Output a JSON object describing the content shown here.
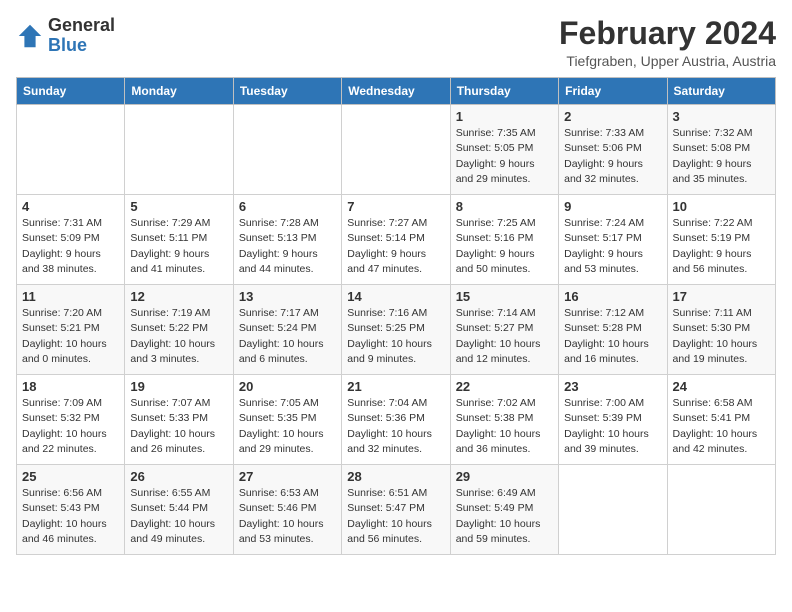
{
  "logo": {
    "line1": "General",
    "line2": "Blue"
  },
  "title": "February 2024",
  "subtitle": "Tiefgraben, Upper Austria, Austria",
  "headers": [
    "Sunday",
    "Monday",
    "Tuesday",
    "Wednesday",
    "Thursday",
    "Friday",
    "Saturday"
  ],
  "weeks": [
    [
      {
        "day": "",
        "info": ""
      },
      {
        "day": "",
        "info": ""
      },
      {
        "day": "",
        "info": ""
      },
      {
        "day": "",
        "info": ""
      },
      {
        "day": "1",
        "info": "Sunrise: 7:35 AM\nSunset: 5:05 PM\nDaylight: 9 hours\nand 29 minutes."
      },
      {
        "day": "2",
        "info": "Sunrise: 7:33 AM\nSunset: 5:06 PM\nDaylight: 9 hours\nand 32 minutes."
      },
      {
        "day": "3",
        "info": "Sunrise: 7:32 AM\nSunset: 5:08 PM\nDaylight: 9 hours\nand 35 minutes."
      }
    ],
    [
      {
        "day": "4",
        "info": "Sunrise: 7:31 AM\nSunset: 5:09 PM\nDaylight: 9 hours\nand 38 minutes."
      },
      {
        "day": "5",
        "info": "Sunrise: 7:29 AM\nSunset: 5:11 PM\nDaylight: 9 hours\nand 41 minutes."
      },
      {
        "day": "6",
        "info": "Sunrise: 7:28 AM\nSunset: 5:13 PM\nDaylight: 9 hours\nand 44 minutes."
      },
      {
        "day": "7",
        "info": "Sunrise: 7:27 AM\nSunset: 5:14 PM\nDaylight: 9 hours\nand 47 minutes."
      },
      {
        "day": "8",
        "info": "Sunrise: 7:25 AM\nSunset: 5:16 PM\nDaylight: 9 hours\nand 50 minutes."
      },
      {
        "day": "9",
        "info": "Sunrise: 7:24 AM\nSunset: 5:17 PM\nDaylight: 9 hours\nand 53 minutes."
      },
      {
        "day": "10",
        "info": "Sunrise: 7:22 AM\nSunset: 5:19 PM\nDaylight: 9 hours\nand 56 minutes."
      }
    ],
    [
      {
        "day": "11",
        "info": "Sunrise: 7:20 AM\nSunset: 5:21 PM\nDaylight: 10 hours\nand 0 minutes."
      },
      {
        "day": "12",
        "info": "Sunrise: 7:19 AM\nSunset: 5:22 PM\nDaylight: 10 hours\nand 3 minutes."
      },
      {
        "day": "13",
        "info": "Sunrise: 7:17 AM\nSunset: 5:24 PM\nDaylight: 10 hours\nand 6 minutes."
      },
      {
        "day": "14",
        "info": "Sunrise: 7:16 AM\nSunset: 5:25 PM\nDaylight: 10 hours\nand 9 minutes."
      },
      {
        "day": "15",
        "info": "Sunrise: 7:14 AM\nSunset: 5:27 PM\nDaylight: 10 hours\nand 12 minutes."
      },
      {
        "day": "16",
        "info": "Sunrise: 7:12 AM\nSunset: 5:28 PM\nDaylight: 10 hours\nand 16 minutes."
      },
      {
        "day": "17",
        "info": "Sunrise: 7:11 AM\nSunset: 5:30 PM\nDaylight: 10 hours\nand 19 minutes."
      }
    ],
    [
      {
        "day": "18",
        "info": "Sunrise: 7:09 AM\nSunset: 5:32 PM\nDaylight: 10 hours\nand 22 minutes."
      },
      {
        "day": "19",
        "info": "Sunrise: 7:07 AM\nSunset: 5:33 PM\nDaylight: 10 hours\nand 26 minutes."
      },
      {
        "day": "20",
        "info": "Sunrise: 7:05 AM\nSunset: 5:35 PM\nDaylight: 10 hours\nand 29 minutes."
      },
      {
        "day": "21",
        "info": "Sunrise: 7:04 AM\nSunset: 5:36 PM\nDaylight: 10 hours\nand 32 minutes."
      },
      {
        "day": "22",
        "info": "Sunrise: 7:02 AM\nSunset: 5:38 PM\nDaylight: 10 hours\nand 36 minutes."
      },
      {
        "day": "23",
        "info": "Sunrise: 7:00 AM\nSunset: 5:39 PM\nDaylight: 10 hours\nand 39 minutes."
      },
      {
        "day": "24",
        "info": "Sunrise: 6:58 AM\nSunset: 5:41 PM\nDaylight: 10 hours\nand 42 minutes."
      }
    ],
    [
      {
        "day": "25",
        "info": "Sunrise: 6:56 AM\nSunset: 5:43 PM\nDaylight: 10 hours\nand 46 minutes."
      },
      {
        "day": "26",
        "info": "Sunrise: 6:55 AM\nSunset: 5:44 PM\nDaylight: 10 hours\nand 49 minutes."
      },
      {
        "day": "27",
        "info": "Sunrise: 6:53 AM\nSunset: 5:46 PM\nDaylight: 10 hours\nand 53 minutes."
      },
      {
        "day": "28",
        "info": "Sunrise: 6:51 AM\nSunset: 5:47 PM\nDaylight: 10 hours\nand 56 minutes."
      },
      {
        "day": "29",
        "info": "Sunrise: 6:49 AM\nSunset: 5:49 PM\nDaylight: 10 hours\nand 59 minutes."
      },
      {
        "day": "",
        "info": ""
      },
      {
        "day": "",
        "info": ""
      }
    ]
  ]
}
